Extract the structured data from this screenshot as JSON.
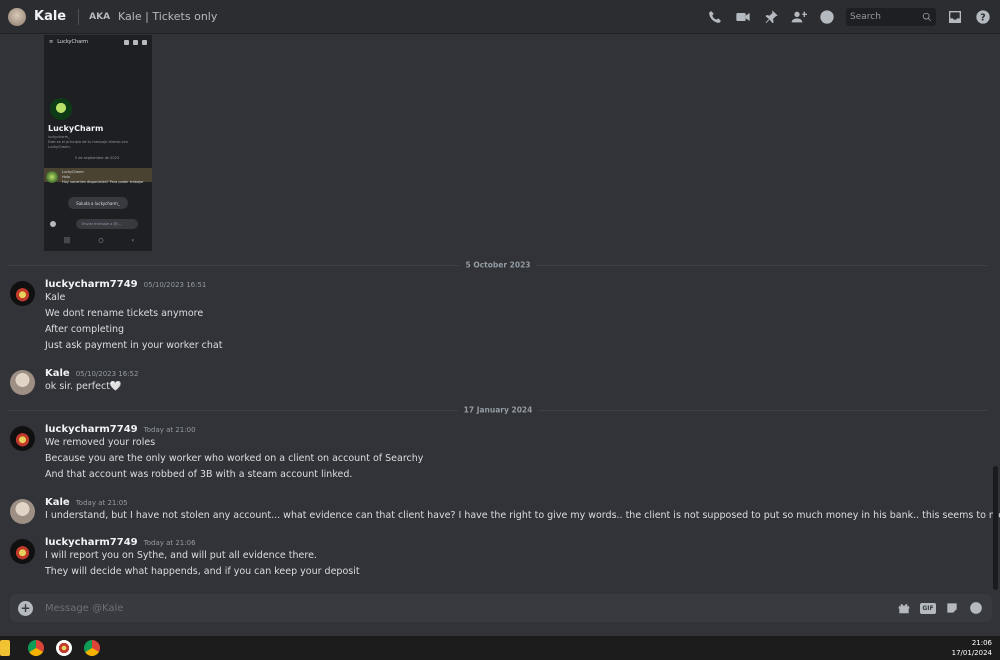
{
  "header": {
    "name": "Kale",
    "aka_label": "AKA",
    "nickname": "Kale | Tickets only",
    "search_placeholder": "Search"
  },
  "embedded_screenshot": {
    "bar_title": "LuckyCharm",
    "name": "LuckyCharm",
    "handle": "luckycharm_",
    "intro": "Este es el principio de tu mensaje directo con LuckyCharm.",
    "date": "5 de septiembre de 2023",
    "msg_user": "LuckyCharm",
    "msg_text": "Hola",
    "msg_text2": "Hay vacantes disponibles? Para poder trabajar",
    "wave_button": "Saluda a luckycharm_",
    "input_placeholder": "Enviar mensaje a @l...",
    "nav": [
      "|||",
      "○",
      "‹"
    ]
  },
  "dividers": [
    "5 October 2023",
    "17 January 2024"
  ],
  "messages": [
    {
      "user": "luckycharm7749",
      "time": "05/10/2023 16:51",
      "lines": [
        "Kale",
        "We dont rename tickets anymore",
        "After completing",
        "Just ask payment in your worker chat"
      ]
    },
    {
      "user": "Kale",
      "time": "05/10/2023 16:52",
      "lines": [
        "ok sir.  perfect🤍"
      ]
    },
    {
      "user": "luckycharm7749",
      "time": "Today at 21:00",
      "lines": [
        "We removed your roles",
        "Because you are the only worker who worked on a client on account of Searchy",
        "And that account was robbed of 3B with a steam account linked."
      ]
    },
    {
      "user": "Kale",
      "time": "Today at 21:05",
      "lines": [
        "I understand, but I have not stolen any account... what evidence can that client have? I have the right to give my words.. the client is not supposed to put so much money in his bank.. this seems to me to be a trap.."
      ]
    },
    {
      "user": "luckycharm7749",
      "time": "Today at 21:06",
      "lines": [
        "I will report you on Sythe, and will put all evidence there.",
        "They will decide what happends, and if you can keep your deposit"
      ]
    }
  ],
  "composer": {
    "placeholder": "Message @Kale",
    "gif_label": "GIF"
  },
  "taskbar": {
    "time": "21:06",
    "date": "17/01/2024"
  }
}
